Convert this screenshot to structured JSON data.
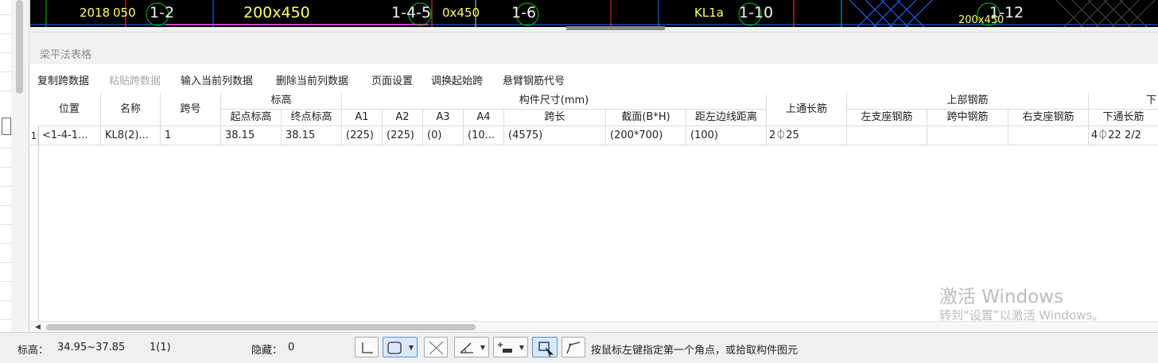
{
  "cad_labels": [
    {
      "text": "2018",
      "kind": "small"
    },
    {
      "text": "050",
      "kind": "small"
    },
    {
      "text": "1-2",
      "kind": "axis"
    },
    {
      "text": "200x450",
      "kind": "dim"
    },
    {
      "text": "1-4-5",
      "kind": "axis"
    },
    {
      "text": "0x450",
      "kind": "small"
    },
    {
      "text": "1-6",
      "kind": "axis"
    },
    {
      "text": "KL1a",
      "kind": "small"
    },
    {
      "text": "1-10",
      "kind": "axis"
    },
    {
      "text": "1-12",
      "kind": "axis"
    },
    {
      "text": "200x450",
      "kind": "small"
    }
  ],
  "panel": {
    "title": "梁平法表格"
  },
  "toolbar": {
    "items": [
      {
        "label": "复制跨数据",
        "enabled": true
      },
      {
        "label": "粘贴跨数据",
        "enabled": false
      },
      {
        "label": "输入当前列数据",
        "enabled": true
      },
      {
        "label": "删除当前列数据",
        "enabled": true
      },
      {
        "label": "页面设置",
        "enabled": true
      },
      {
        "label": "调换起始跨",
        "enabled": true
      },
      {
        "label": "悬臂钢筋代号",
        "enabled": true
      }
    ]
  },
  "table": {
    "group_headers": {
      "location": "位置",
      "name": "名称",
      "span": "跨号",
      "elevation": "标高",
      "size": "构件尺寸(mm)",
      "top_through": "上通长筋",
      "top_rebar": "上部钢筋",
      "extra": "下"
    },
    "sub_headers": {
      "start_elev": "起点标高",
      "end_elev": "终点标高",
      "a1": "A1",
      "a2": "A2",
      "a3": "A3",
      "a4": "A4",
      "span_len": "跨长",
      "section": "截面(B*H)",
      "dist_left": "距左边线距离",
      "left_support": "左支座钢筋",
      "mid_span": "跨中钢筋",
      "right_support": "右支座钢筋",
      "bottom_through": "下通长筋"
    },
    "rows": [
      {
        "row_no": "1",
        "location": "<1-4-1...",
        "name": "KL8(2)...",
        "span": "1",
        "start_elev": "38.15",
        "end_elev": "38.15",
        "a1": "(225)",
        "a2": "(225)",
        "a3": "(0)",
        "a4": "(10...",
        "span_len": "(4575)",
        "section": "(200*700)",
        "dist_left": "(100)",
        "top_through": "2⏀25",
        "left_support": "",
        "mid_span": "",
        "right_support": "",
        "bottom_through": "4⏀22 2/2"
      }
    ]
  },
  "watermark": {
    "line1": "激活 Windows",
    "line2": "转到“设置”以激活 Windows。"
  },
  "status": {
    "elev_label": "标高：",
    "elev_value": "34.95~37.85",
    "count": "1(1)",
    "hidden_label": "隐藏：",
    "hidden_value": "0",
    "hint": "按鼠标左键指定第一个角点，或拾取构件图元"
  },
  "tools": [
    {
      "icon": "point-select-icon",
      "active": false,
      "dropdown": false
    },
    {
      "icon": "rectangle-select-icon",
      "active": true,
      "dropdown": true
    },
    {
      "icon": "cross-select-icon",
      "active": false,
      "dropdown": false
    },
    {
      "icon": "angle-icon",
      "active": false,
      "dropdown": true
    },
    {
      "icon": "offset-icon",
      "active": false,
      "dropdown": true
    },
    {
      "icon": "screen-select-icon",
      "active": true,
      "dropdown": false
    },
    {
      "icon": "polyline-select-icon",
      "active": false,
      "dropdown": false
    }
  ]
}
